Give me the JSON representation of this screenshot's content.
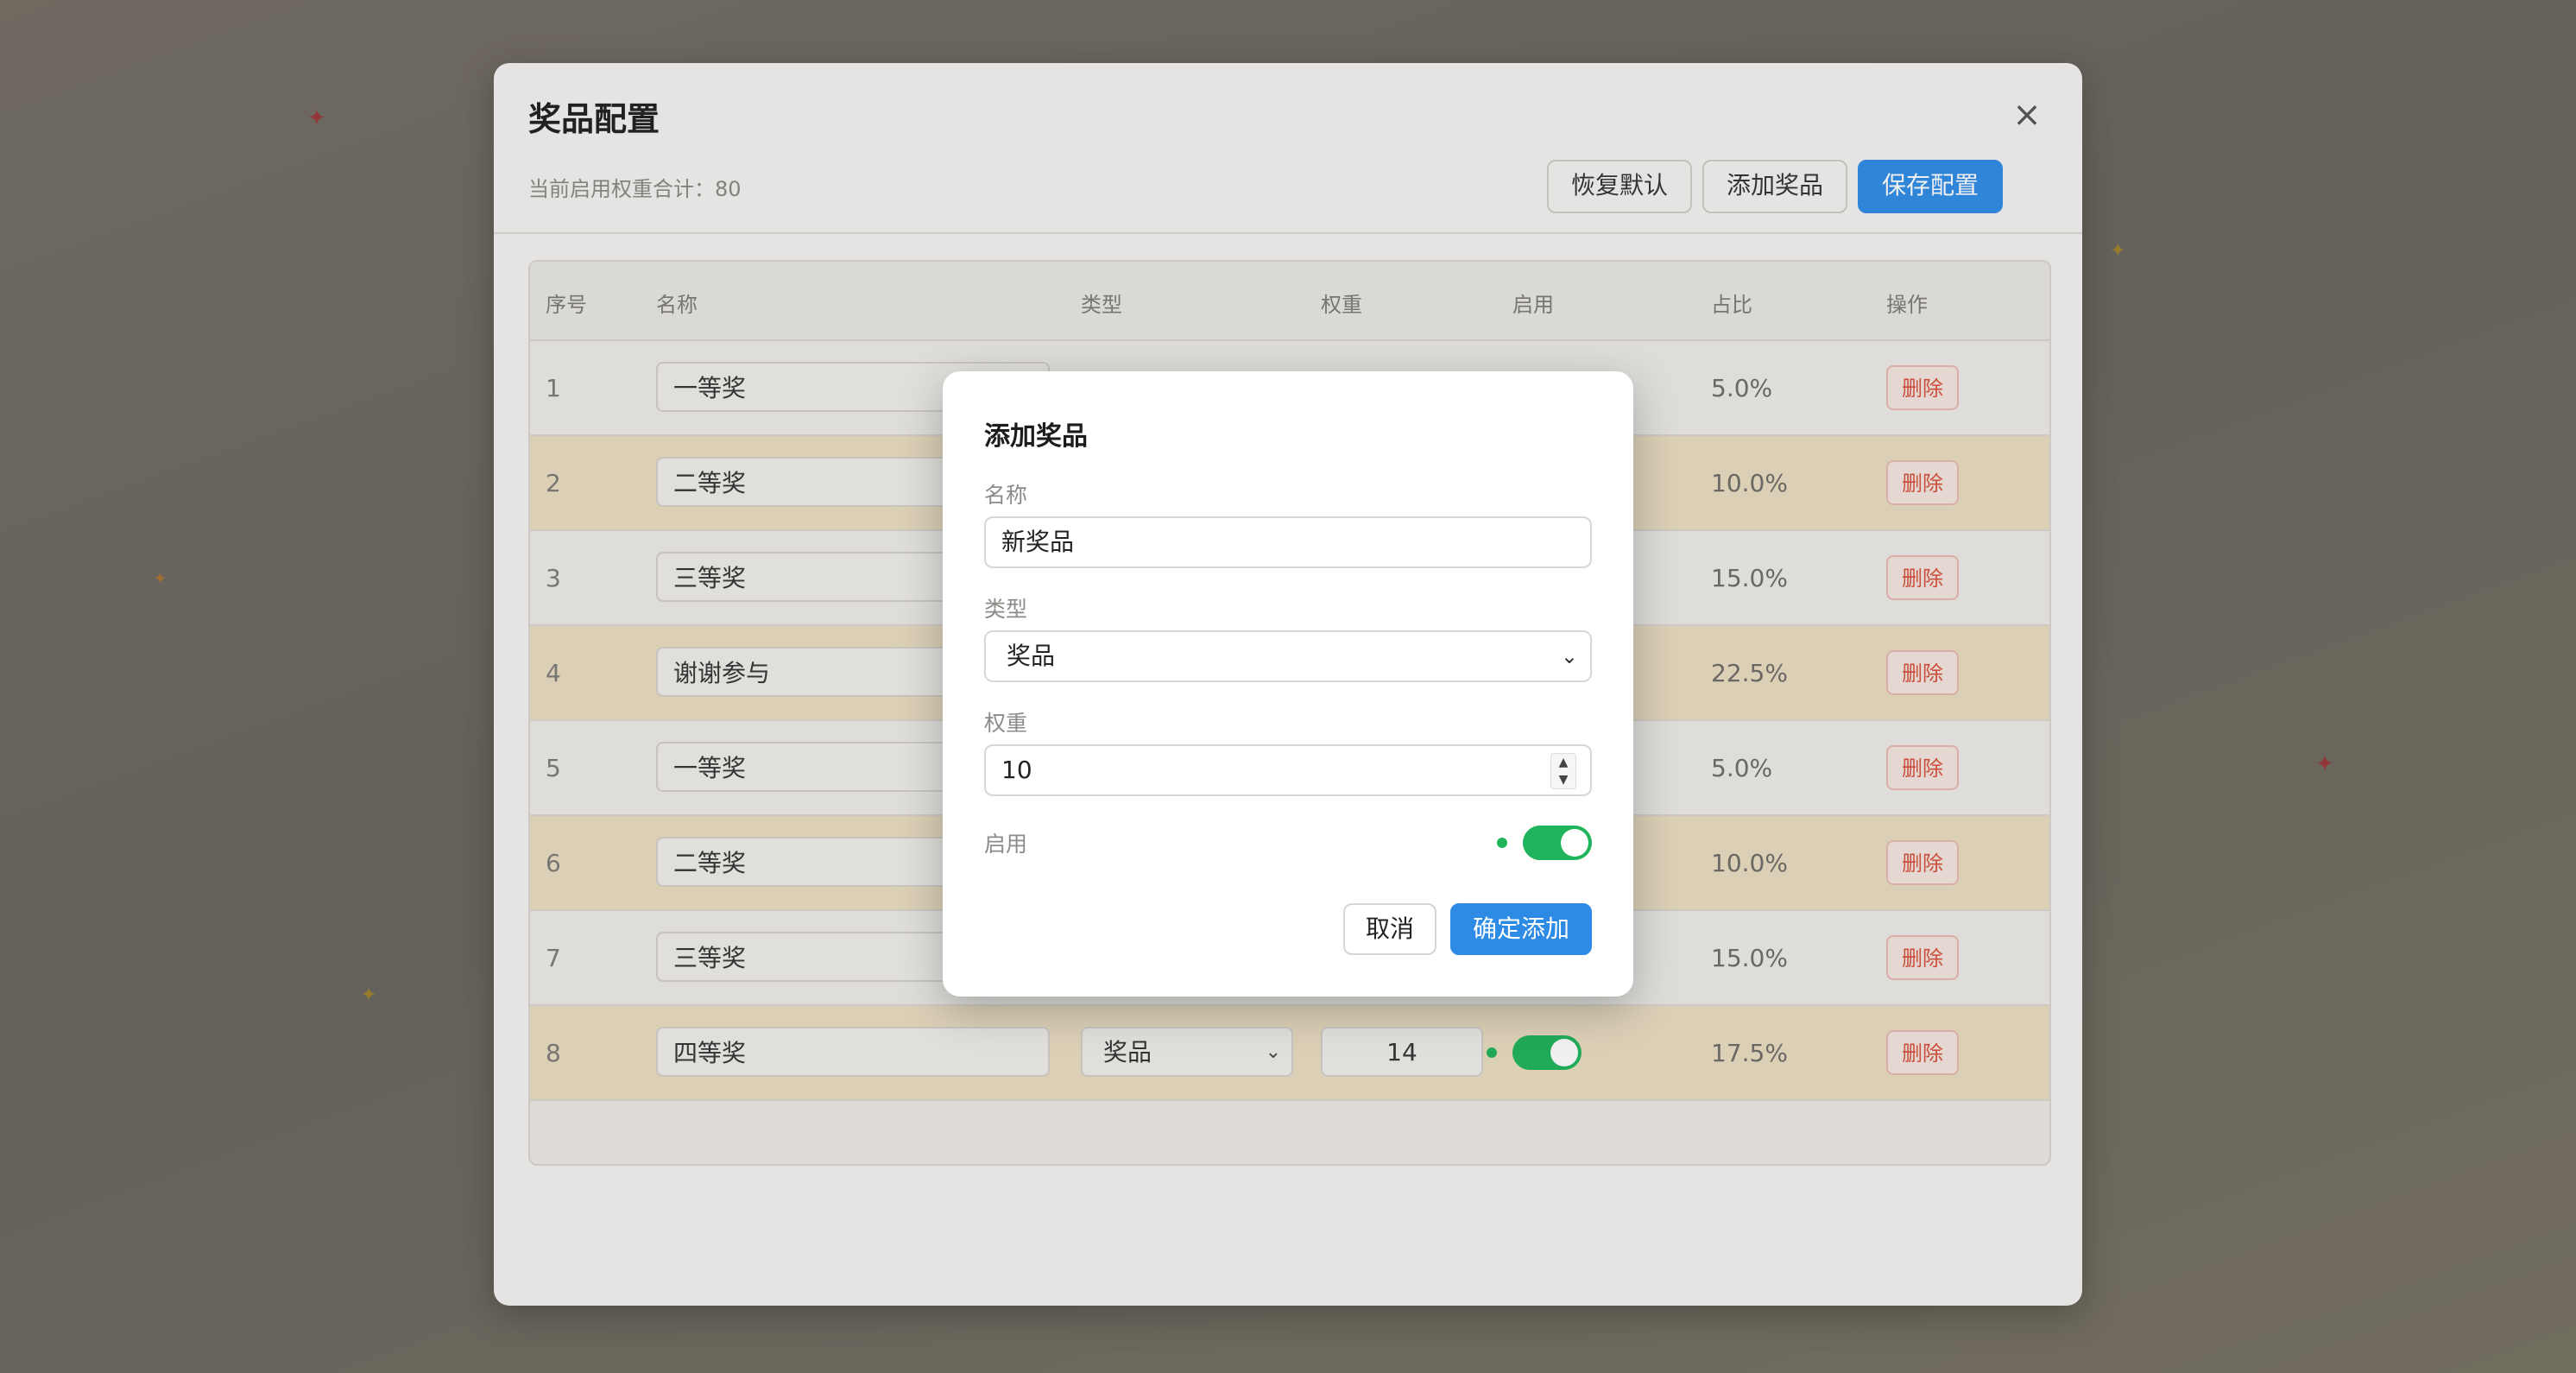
{
  "panel": {
    "title": "奖品配置",
    "weight_summary": "当前启用权重合计：80",
    "close_icon": "×",
    "buttons": {
      "reset": "恢复默认",
      "add": "添加奖品",
      "save": "保存配置"
    }
  },
  "table": {
    "headers": [
      "序号",
      "名称",
      "类型",
      "权重",
      "启用",
      "占比",
      "操作"
    ],
    "rows": [
      {
        "index": "1",
        "name": "一等奖",
        "percent": "5.0%",
        "action": "删除"
      },
      {
        "index": "2",
        "name": "二等奖",
        "percent": "10.0%",
        "action": "删除"
      },
      {
        "index": "3",
        "name": "三等奖",
        "percent": "15.0%",
        "action": "删除"
      },
      {
        "index": "4",
        "name": "谢谢参与",
        "percent": "22.5%",
        "action": "删除"
      },
      {
        "index": "5",
        "name": "一等奖",
        "percent": "5.0%",
        "action": "删除"
      },
      {
        "index": "6",
        "name": "二等奖",
        "percent": "10.0%",
        "action": "删除"
      },
      {
        "index": "7",
        "name": "三等奖",
        "percent": "15.0%",
        "action": "删除"
      },
      {
        "index": "8",
        "name": "四等奖",
        "type": "奖品",
        "weight": "14",
        "enabled": true,
        "percent": "17.5%",
        "action": "删除"
      }
    ]
  },
  "dialog": {
    "title": "添加奖品",
    "name_label": "名称",
    "name_value": "新奖品",
    "type_label": "类型",
    "type_value": "奖品",
    "weight_label": "权重",
    "weight_value": "10",
    "enabled_label": "启用",
    "enabled": true,
    "cancel": "取消",
    "confirm": "确定添加"
  },
  "colors": {
    "primary": "#2e8be5",
    "toggle_on": "#1fb35b",
    "danger": "#d6503a",
    "row_highlight": "#e9dcc0"
  }
}
